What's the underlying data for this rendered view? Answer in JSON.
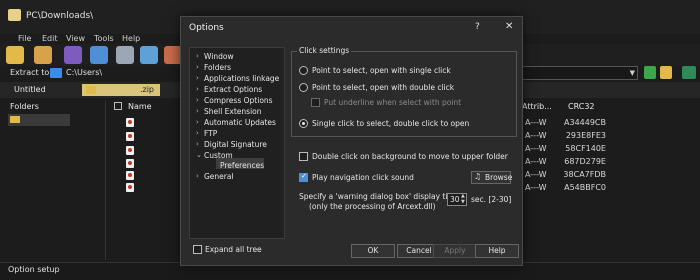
{
  "window": {
    "title": "PC\\Downloads\\"
  },
  "menu": [
    "File",
    "Edit",
    "View",
    "Tools",
    "Help"
  ],
  "extract": {
    "label": "Extract to",
    "path": "C:\\Users\\"
  },
  "tabs": {
    "first": "Untitled",
    "second": ".zip"
  },
  "folders_header": "Folders",
  "file_list": {
    "name_header": "Name",
    "attrib_header": "Attrib...",
    "crc_header": "CRC32",
    "rows": [
      {
        "attrib": "A---W",
        "crc": "A34449CB"
      },
      {
        "attrib": "A---W",
        "crc": "293E8FE3"
      },
      {
        "attrib": "A---W",
        "crc": "58CF140E"
      },
      {
        "attrib": "A---W",
        "crc": "687D279E"
      },
      {
        "attrib": "A---W",
        "crc": "38CA7FDB"
      },
      {
        "attrib": "A---W",
        "crc": "A54BBFC0"
      }
    ]
  },
  "status": "Option setup",
  "dialog": {
    "title": "Options",
    "help": "?",
    "close": "✕",
    "tree": [
      {
        "label": "Window",
        "chevron": "›"
      },
      {
        "label": "Folders",
        "chevron": "›"
      },
      {
        "label": "Applications linkage",
        "chevron": "›"
      },
      {
        "label": "Extract Options",
        "chevron": "›"
      },
      {
        "label": "Compress Options",
        "chevron": "›"
      },
      {
        "label": "Shell Extension",
        "chevron": "›"
      },
      {
        "label": "Automatic Updates",
        "chevron": "›"
      },
      {
        "label": "FTP",
        "chevron": "›"
      },
      {
        "label": "Digital Signature",
        "chevron": "›"
      },
      {
        "label": "Custom",
        "chevron": "⌄"
      },
      {
        "label": "Preferences",
        "chevron": ""
      },
      {
        "label": "General",
        "chevron": "›"
      }
    ],
    "expand_all": "Expand all tree",
    "click_settings": {
      "legend": "Click settings",
      "opt1": "Point to select, open with single click",
      "opt2": "Point to select, open with double click",
      "opt2_sub": "Put underline when select with point",
      "opt3": "Single click to select, double click to open"
    },
    "double_click_bg": "Double click on background to move to upper folder",
    "play_sound": "Play navigation click sound",
    "browse": "Browse",
    "warning_label_1": "Specify a 'warning dialog box' display time",
    "warning_label_2": "(only the processing of Arcext.dll)",
    "warning_value": "30",
    "warning_suffix": "sec. [2-30]",
    "buttons": {
      "ok": "OK",
      "cancel": "Cancel",
      "apply": "Apply",
      "help": "Help"
    }
  }
}
